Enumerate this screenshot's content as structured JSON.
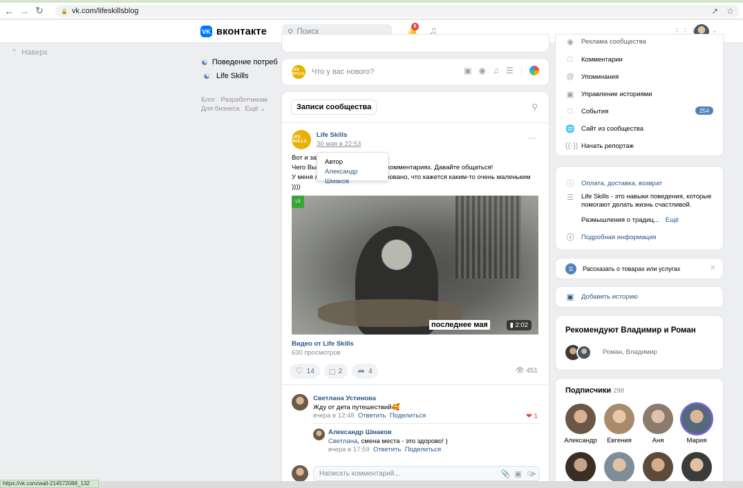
{
  "browser": {
    "url": "vk.com/lifeskillsblog",
    "status_url": "https://vk.com/wall-214572088_132"
  },
  "header": {
    "logo_text": "вконтакте",
    "search_placeholder": "Поиск",
    "notifications_count": "6"
  },
  "left": {
    "up_label": "Наверх",
    "nav_items": [
      {
        "label": "Поведение потреб..."
      },
      {
        "label": "Life Skills"
      }
    ],
    "footer_line1": "Блог   Разработчикам",
    "footer_line2": "Для бизнеса   Ещё ⌄"
  },
  "composer": {
    "placeholder": "Что у вас нового?",
    "avatar_text": "LIFE SKILLS"
  },
  "wall": {
    "tab_label": "Записи сообщества",
    "post": {
      "author": "Life Skills",
      "date": "30 мая в 22:53",
      "avatar_text": "LIFE SKILLS",
      "text_line1": "Вот и зак",
      "text_line2_a": "Чего Вы",
      "text_line2_b": "сь в комментариях. Давайте общаться!",
      "text_line3_a": "У меня л",
      "text_line3_b": "ровано, что кажется каким-то очень маленьким",
      "text_line4": "))))",
      "tooltip_label": "Автор",
      "tooltip_name": "Александр Шмаков",
      "video_caption": "последнее мая",
      "video_duration": "2:02",
      "video_title": "Видео от Life Skills",
      "video_views": "630 просмотров",
      "likes": "14",
      "comments": "2",
      "shares": "4",
      "views": "451"
    },
    "comments": [
      {
        "name": "Светлана Устинова",
        "text": "Жду от дета путешествий🥰",
        "time": "вчера в 12:48",
        "reply": "Ответить",
        "share": "Поделиться",
        "likes": "1"
      },
      {
        "name": "Александр Шмаков",
        "mention": "Светлана",
        "text": ", смена места - это здорово! )",
        "time": "вчера в 17:59",
        "reply": "Ответить",
        "share": "Поделиться"
      }
    ],
    "reply_placeholder": "Написать комментарий..."
  },
  "right": {
    "menu_top_cut": "Реклама сообщества",
    "menu": [
      {
        "label": "Комментарии",
        "icon": "comment-icon"
      },
      {
        "label": "Упоминания",
        "icon": "at-icon"
      },
      {
        "label": "Управление историями",
        "icon": "stories-icon"
      },
      {
        "label": "События",
        "icon": "events-icon",
        "badge": "254"
      },
      {
        "label": "Сайт из сообщества",
        "icon": "globe-icon"
      },
      {
        "label": "Начать репортаж",
        "icon": "broadcast-icon"
      }
    ],
    "info": {
      "payment": "Оплата, доставка, возврат",
      "desc_line1": "Life Skills - это навыки поведения, которые",
      "desc_line2": "помогают делать жизнь счастливой.",
      "desc_line3": "Размышления о традиц...",
      "more": "Ещё",
      "details": "Подробная информация"
    },
    "tell": "Рассказать о товарах или услугах",
    "add_story": "Добавить историю",
    "recommend": {
      "title": "Рекомендуют Владимир и Роман",
      "names": "Роман, Владимир"
    },
    "subscribers": {
      "title": "Подписчики",
      "count": "298",
      "people": [
        {
          "name": "Александр"
        },
        {
          "name": "Евгения"
        },
        {
          "name": "Аня"
        },
        {
          "name": "Мария"
        }
      ]
    }
  },
  "colors": {
    "link": "#2a5885",
    "accent": "#5181b8",
    "background": "#edeef0",
    "vk_blue": "#0077ff"
  }
}
